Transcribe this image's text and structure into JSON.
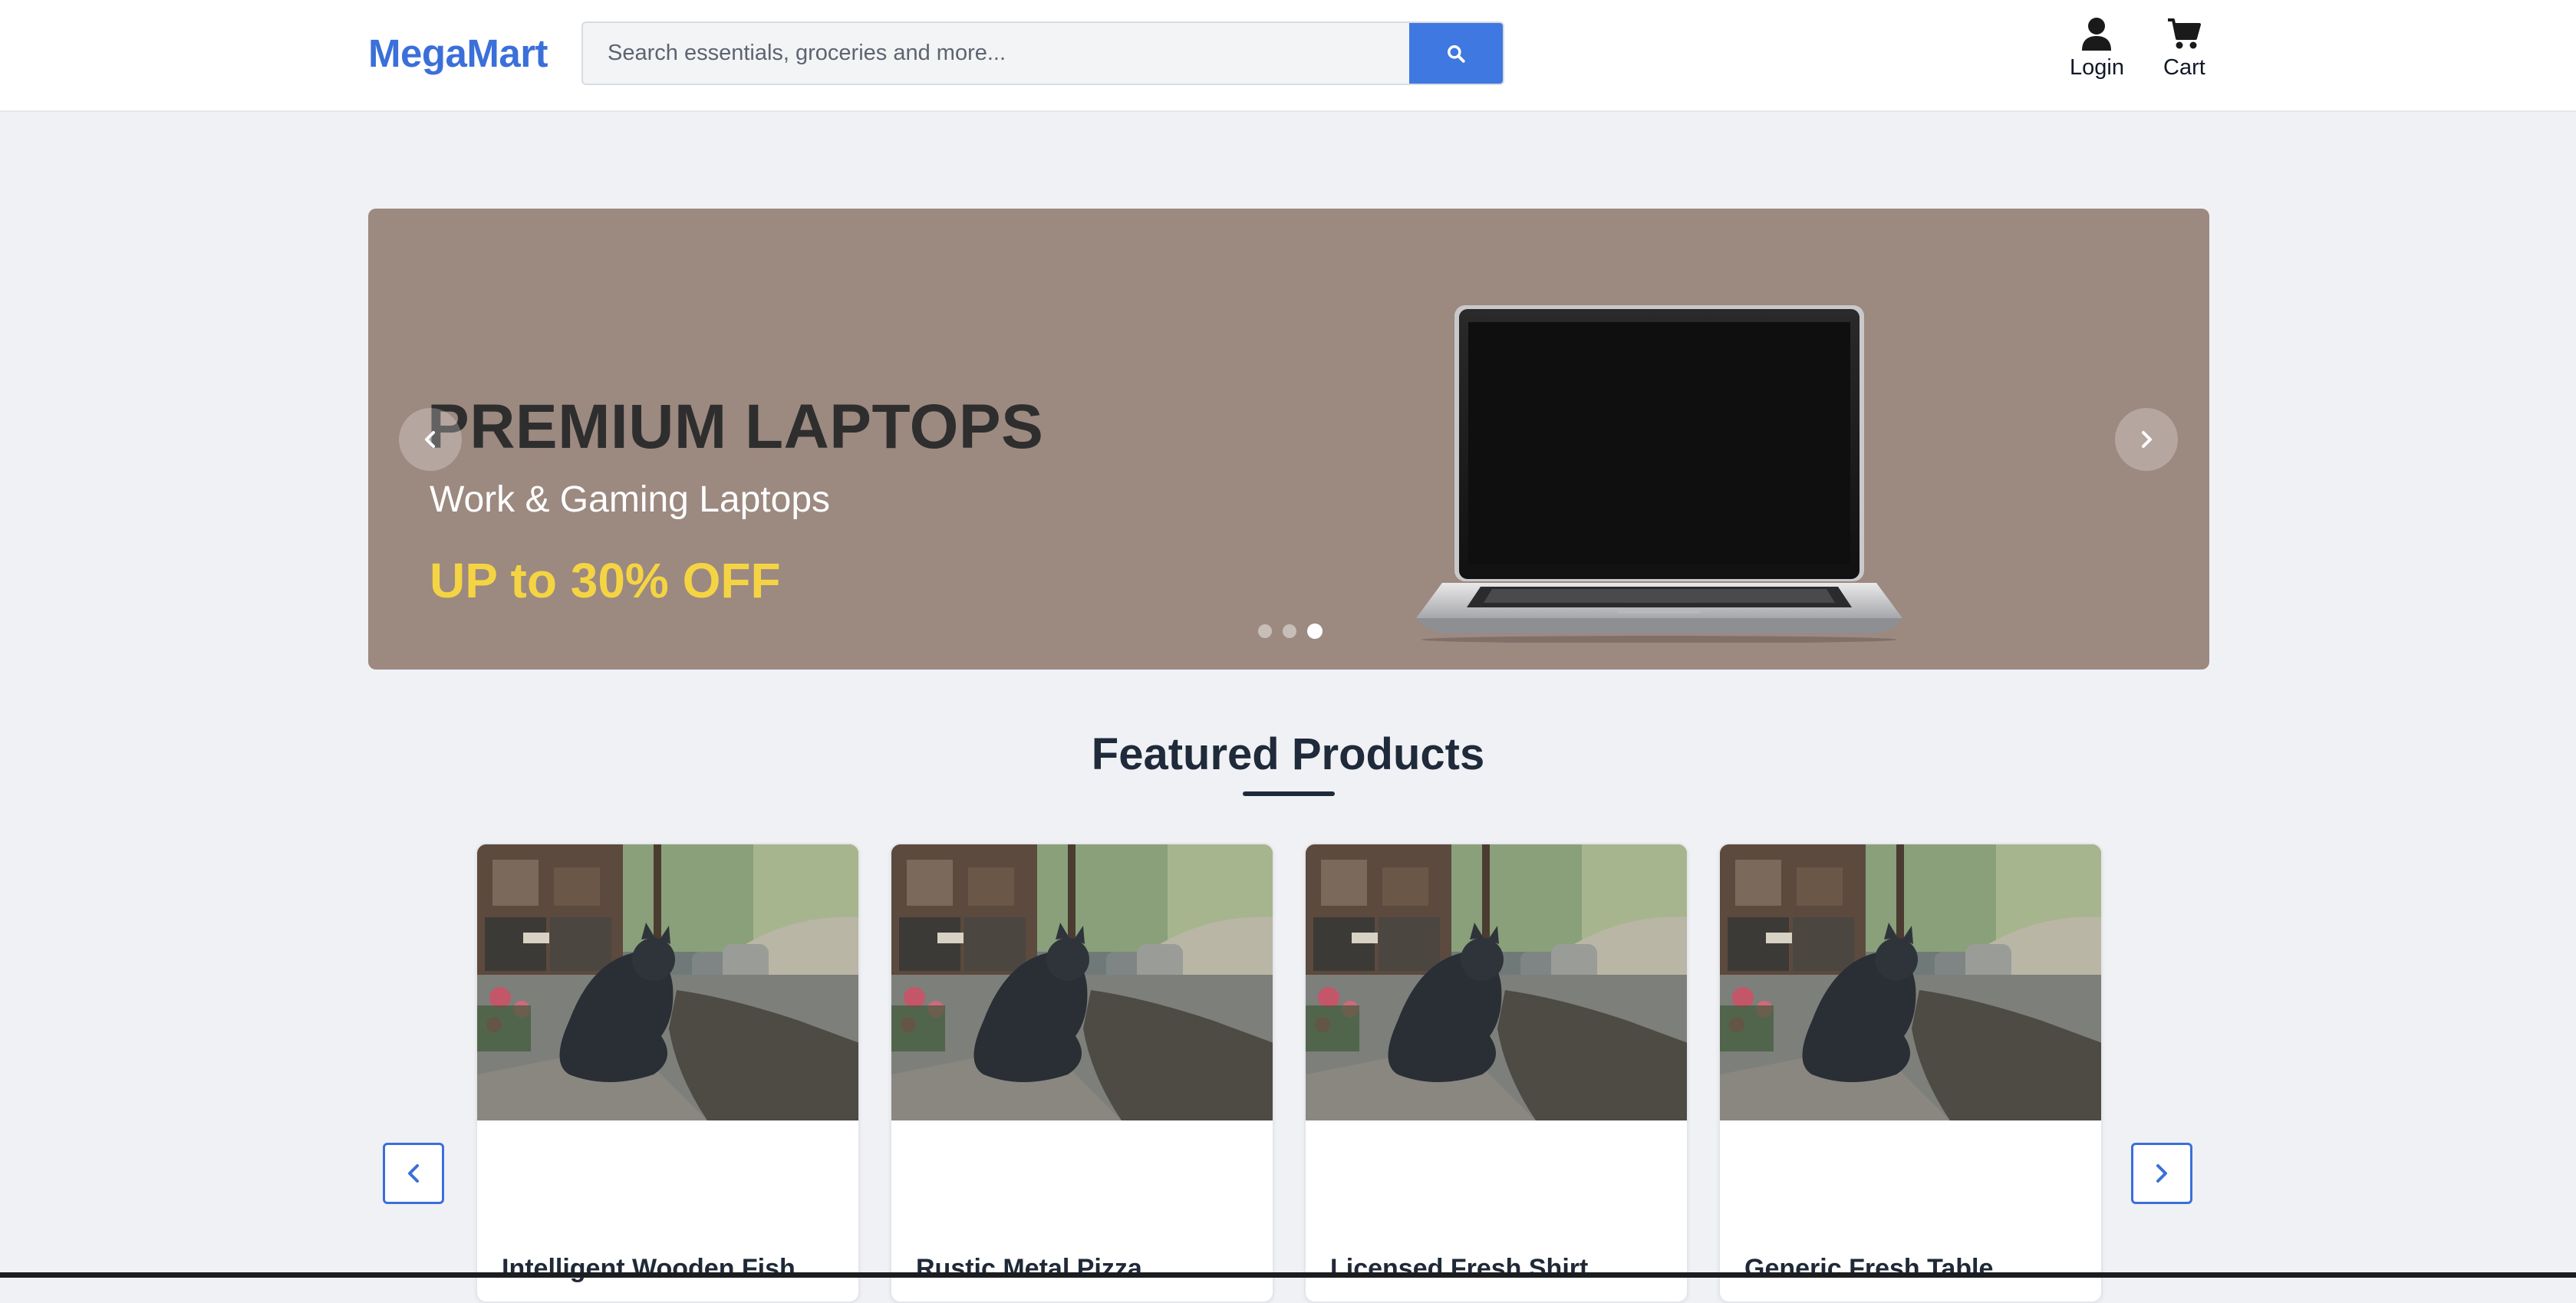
{
  "header": {
    "logo": "MegaMart",
    "search": {
      "placeholder": "Search essentials, groceries and more...",
      "value": ""
    },
    "login_label": "Login",
    "cart_label": "Cart",
    "accent": "#3f78e0"
  },
  "banner": {
    "title": "PREMIUM LAPTOPS",
    "subtitle": "Work & Gaming Laptops",
    "offer": "UP to 30% OFF",
    "background": "#9c8980",
    "offer_color": "#f5d443",
    "slide_count": 3,
    "active_slide": 3
  },
  "featured": {
    "title": "Featured Products",
    "products": [
      {
        "name": "Intelligent Wooden Fish"
      },
      {
        "name": "Rustic Metal Pizza"
      },
      {
        "name": "Licensed Fresh Shirt"
      },
      {
        "name": "Generic Fresh Table"
      }
    ]
  }
}
